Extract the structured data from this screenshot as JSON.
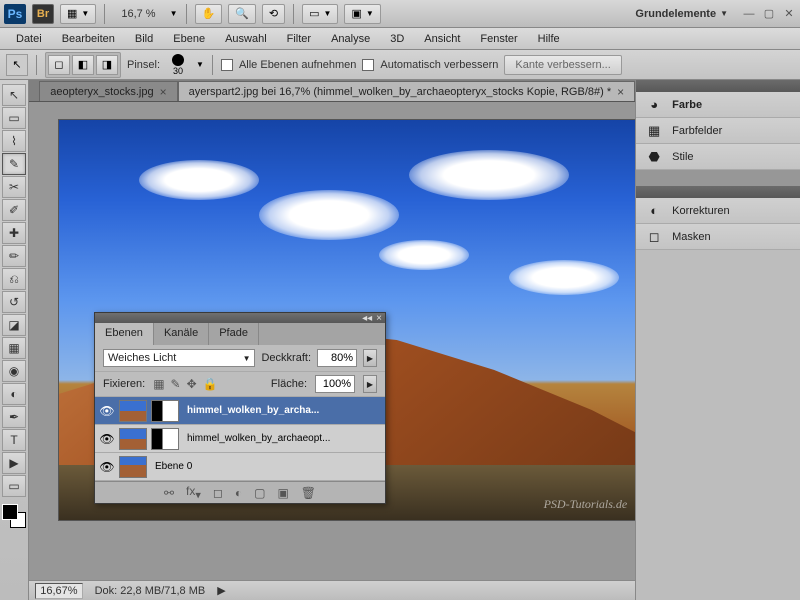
{
  "appbar": {
    "zoom": "16,7 %",
    "workspace": "Grundelemente"
  },
  "menu": [
    "Datei",
    "Bearbeiten",
    "Bild",
    "Ebene",
    "Auswahl",
    "Filter",
    "Analyse",
    "3D",
    "Ansicht",
    "Fenster",
    "Hilfe"
  ],
  "options": {
    "brush_label": "Pinsel:",
    "brush_size": "30",
    "all_layers": "Alle Ebenen aufnehmen",
    "auto_enhance": "Automatisch verbessern",
    "refine_edge": "Kante verbessern..."
  },
  "tabs": {
    "tab1_label": "aeopteryx_stocks.jpg",
    "tab2_label": "ayerspart2.jpg bei 16,7% (himmel_wolken_by_archaeopteryx_stocks Kopie, RGB/8#) *"
  },
  "status": {
    "zoom": "16,67%",
    "doc": "Dok: 22,8 MB/71,8 MB"
  },
  "right_panels": {
    "farbe": "Farbe",
    "farbfelder": "Farbfelder",
    "stile": "Stile",
    "korrekturen": "Korrekturen",
    "masken": "Masken"
  },
  "layers_panel": {
    "tab_ebenen": "Ebenen",
    "tab_kanaele": "Kanäle",
    "tab_pfade": "Pfade",
    "blend_mode": "Weiches Licht",
    "opacity_label": "Deckkraft:",
    "opacity_value": "80%",
    "lock_label": "Fixieren:",
    "fill_label": "Fläche:",
    "fill_value": "100%",
    "layer1": "himmel_wolken_by_archa...",
    "layer2": "himmel_wolken_by_archaeopt...",
    "layer3": "Ebene 0"
  },
  "watermark": "PSD-Tutorials.de"
}
